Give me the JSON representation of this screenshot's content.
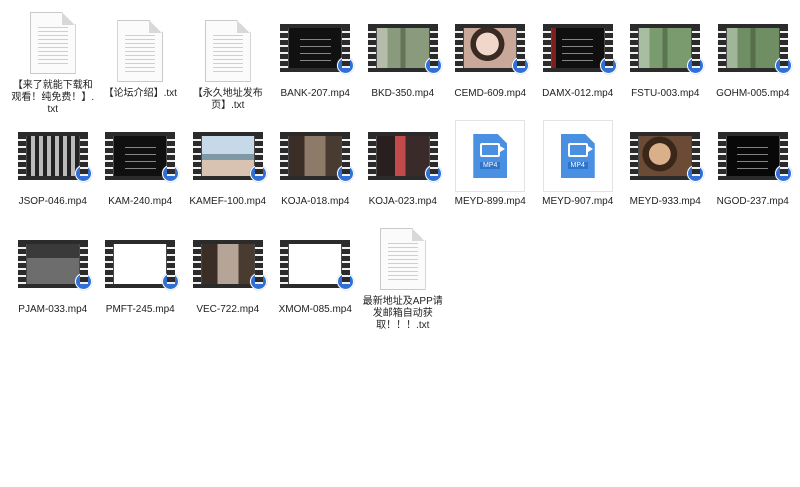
{
  "files": [
    {
      "name": "【来了就能下载和观看！纯免费！】.txt",
      "kind": "txt"
    },
    {
      "name": "【论坛介绍】.txt",
      "kind": "txt"
    },
    {
      "name": "【永久地址发布页】.txt",
      "kind": "txt"
    },
    {
      "name": "BANK-207.mp4",
      "kind": "video",
      "frame": "dark-text",
      "color": "#111111"
    },
    {
      "name": "BKD-350.mp4",
      "kind": "video",
      "frame": "outdoor",
      "color": "#8a9a7c"
    },
    {
      "name": "CEMD-609.mp4",
      "kind": "video",
      "frame": "portrait",
      "color": "#c9a89a"
    },
    {
      "name": "DAMX-012.mp4",
      "kind": "video",
      "frame": "dark-text-red",
      "color": "#0f0f0f"
    },
    {
      "name": "FSTU-003.mp4",
      "kind": "video",
      "frame": "outdoor",
      "color": "#7a9b6e"
    },
    {
      "name": "GOHM-005.mp4",
      "kind": "video",
      "frame": "outdoor",
      "color": "#6f8e63"
    },
    {
      "name": "JSOP-046.mp4",
      "kind": "video",
      "frame": "pattern",
      "color": "#6b6b6b"
    },
    {
      "name": "KAM-240.mp4",
      "kind": "video",
      "frame": "dark-text",
      "color": "#101010"
    },
    {
      "name": "KAMEF-100.mp4",
      "kind": "video",
      "frame": "beach",
      "color": "#9fb6c9"
    },
    {
      "name": "KOJA-018.mp4",
      "kind": "video",
      "frame": "room",
      "color": "#8e7a69"
    },
    {
      "name": "KOJA-023.mp4",
      "kind": "video",
      "frame": "red-scene",
      "color": "#8a4a4a"
    },
    {
      "name": "MEYD-899.mp4",
      "kind": "mp4"
    },
    {
      "name": "MEYD-907.mp4",
      "kind": "mp4"
    },
    {
      "name": "MEYD-933.mp4",
      "kind": "video",
      "frame": "warm",
      "color": "#a57a58"
    },
    {
      "name": "NGOD-237.mp4",
      "kind": "video",
      "frame": "dark-text",
      "color": "#080808"
    },
    {
      "name": "PJAM-033.mp4",
      "kind": "video",
      "frame": "sign",
      "color": "#5a5a5a"
    },
    {
      "name": "PMFT-245.mp4",
      "kind": "video",
      "frame": "blank",
      "color": "#ffffff"
    },
    {
      "name": "VEC-722.mp4",
      "kind": "video",
      "frame": "room",
      "color": "#b6a497"
    },
    {
      "name": "XMOM-085.mp4",
      "kind": "video",
      "frame": "blank",
      "color": "#ffffff"
    },
    {
      "name": "最新地址及APP请发邮箱自动获取！！！.txt",
      "kind": "txt"
    }
  ],
  "icons": {
    "badge": "cloud-sync-icon",
    "mp4_tag": "MP4"
  }
}
